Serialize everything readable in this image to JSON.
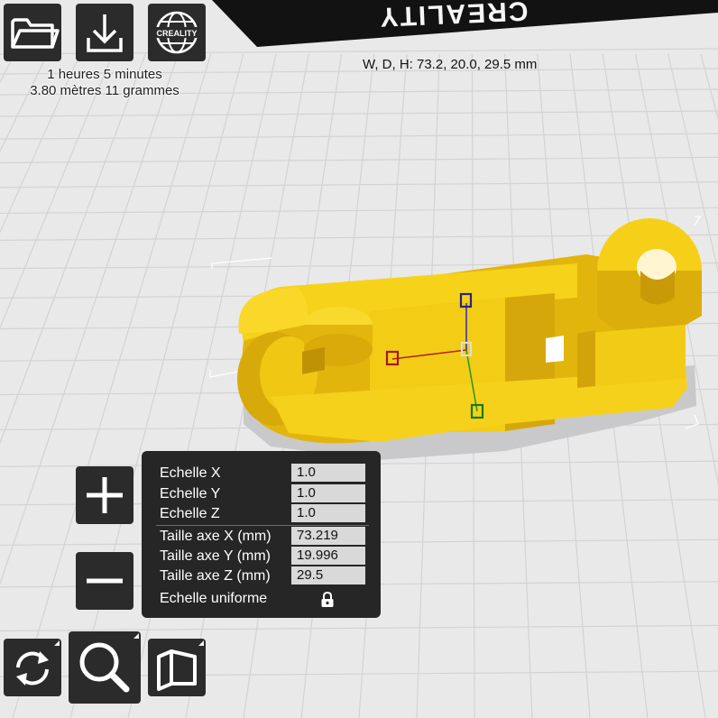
{
  "toolbar": {
    "open_icon": "folder-icon",
    "download_icon": "download-icon",
    "creality_logo": "CREALITY"
  },
  "print_stats": {
    "time": "1 heures 5 minutes",
    "material": "3.80 mètres 11 grammes"
  },
  "bed_branding": "CREALITY",
  "dimensions_readout": "W, D, H: 73.2, 20.0, 29.5 mm",
  "scale_panel": {
    "rows": [
      {
        "label": "Echelle X",
        "value": "1.0"
      },
      {
        "label": "Echelle Y",
        "value": "1.0"
      },
      {
        "label": "Echelle Z",
        "value": "1.0"
      },
      {
        "label": "Taille axe X (mm)",
        "value": "73.219"
      },
      {
        "label": "Taille axe Y (mm)",
        "value": "19.996"
      },
      {
        "label": "Taille axe Z (mm)",
        "value": "29.5"
      }
    ],
    "uniform_label": "Echelle uniforme",
    "uniform_icon": "lock-icon"
  },
  "zoom_controls": {
    "plus_icon": "plus-icon",
    "minus_icon": "minus-icon"
  },
  "view_controls": {
    "rotate_icon": "rotate-icon",
    "zoom_icon": "magnifier-icon",
    "view_icon": "view-mode-icon"
  },
  "colors": {
    "model": "#f4cd12",
    "panel_bg": "#262626",
    "button_bg": "#2b2b2b",
    "grid": "#d4d4d6",
    "background": "#e9e9ea"
  }
}
